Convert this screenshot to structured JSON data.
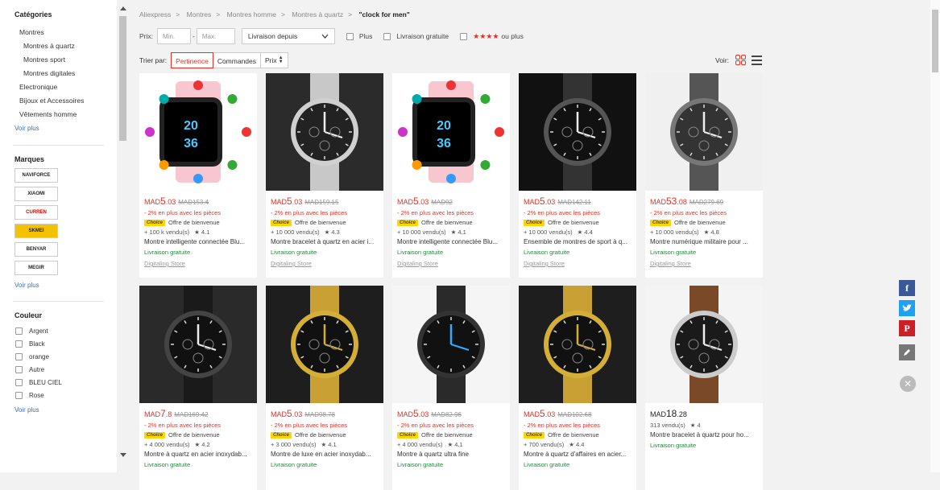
{
  "sidebar": {
    "categories_title": "Catégories",
    "categories": [
      {
        "label": "Montres",
        "sub": false
      },
      {
        "label": "Montres à quartz",
        "sub": true
      },
      {
        "label": "Montres sport",
        "sub": true
      },
      {
        "label": "Montres digitales",
        "sub": true
      },
      {
        "label": "Electronique",
        "sub": false
      },
      {
        "label": "Bijoux et Accessoires",
        "sub": false
      },
      {
        "label": "Vêtements homme",
        "sub": false
      }
    ],
    "see_more": "Voir plus",
    "brands_title": "Marques",
    "brands": [
      "NAVIFORCE",
      "XIAOMI",
      "CURREN",
      "SKMEI",
      "BENYAR",
      "MEGIR"
    ],
    "colors_title": "Couleur",
    "colors": [
      "Argent",
      "Black",
      "orange",
      "Autre",
      "BLEU CIEL",
      "Rose"
    ]
  },
  "breadcrumb": [
    "Aliexpress",
    "Montres",
    "Montres homme",
    "Montres à quartz"
  ],
  "search_query": "\"clock for men\"",
  "filters": {
    "price_label": "Prix:",
    "min_placeholder": "Min.",
    "max_placeholder": "Max.",
    "dash": "-",
    "ship_from": "Livraison depuis",
    "plus": "Plus",
    "free_shipping": "Livraison gratuite",
    "stars": "★★★★",
    "stars_suffix": "ou plus"
  },
  "sort": {
    "label": "Trier par:",
    "options": [
      "Pertinence",
      "Commandes",
      "Prix"
    ],
    "view_label": "Voir:"
  },
  "products": [
    {
      "currency": "MAD",
      "price": "5",
      "cents": ".03",
      "old": "MAD153.4",
      "promo": "- 2% en plus avec les pièces",
      "offer": "Offre de bienvenue",
      "sold": "+ 100 k vendu(s)",
      "rating": "4.1",
      "title": "Montre intelligente connectée Blu...",
      "shipping": "Livraison gratuite",
      "store": "Digitaling Store"
    },
    {
      "currency": "MAD",
      "price": "5",
      "cents": ".03",
      "old": "MAD159.15",
      "promo": "- 2% en plus avec les pièces",
      "offer": "Offre de bienvenue",
      "sold": "+ 10 000 vendu(s)",
      "rating": "4.3",
      "title": "Montre bracelet à quartz en acier i...",
      "shipping": "Livraison gratuite",
      "store": "Digitaling Store"
    },
    {
      "currency": "MAD",
      "price": "5",
      "cents": ".03",
      "old": "MAD92",
      "promo": "- 2% en plus avec les pièces",
      "offer": "Offre de bienvenue",
      "sold": "+ 10 000 vendu(s)",
      "rating": "4.1",
      "title": "Montre intelligente connectée Blu...",
      "shipping": "Livraison gratuite",
      "store": "Digitaling Store"
    },
    {
      "currency": "MAD",
      "price": "5",
      "cents": ".03",
      "old": "MAD142.11",
      "promo": "- 2% en plus avec les pièces",
      "offer": "Offre de bienvenue",
      "sold": "+ 10 000 vendu(s)",
      "rating": "4.4",
      "title": "Ensemble de montres de sport à q...",
      "shipping": "Livraison gratuite",
      "store": "Digitaling Store"
    },
    {
      "currency": "MAD",
      "price": "53",
      "cents": ".08",
      "old": "MAD279.69",
      "promo": "- 2% en plus avec les pièces",
      "offer": "Offre de bienvenue",
      "sold": "+ 10 000 vendu(s)",
      "rating": "4.8",
      "title": "Montre numérique militaire pour ...",
      "shipping": "Livraison gratuite",
      "store": "Digitaling Store"
    },
    {
      "currency": "MAD",
      "price": "7",
      "cents": ".8",
      "old": "MAD169.42",
      "promo": "- 2% en plus avec les pièces",
      "offer": "Offre de bienvenue",
      "sold": "+ 4 000 vendu(s)",
      "rating": "4.2",
      "title": "Montre à quartz en acier inoxydab...",
      "shipping": "Livraison gratuite",
      "store": ""
    },
    {
      "currency": "MAD",
      "price": "5",
      "cents": ".03",
      "old": "MAD98.78",
      "promo": "- 2% en plus avec les pièces",
      "offer": "Offre de bienvenue",
      "sold": "+ 3 000 vendu(s)",
      "rating": "4.1",
      "title": "Montre de luxe en acier inoxydab...",
      "shipping": "Livraison gratuite",
      "store": ""
    },
    {
      "currency": "MAD",
      "price": "5",
      "cents": ".03",
      "old": "MAD82.96",
      "promo": "- 2% en plus avec les pièces",
      "offer": "Offre de bienvenue",
      "sold": "+ 4 000 vendu(s)",
      "rating": "4.1",
      "title": "Montre à quartz ultra fine",
      "shipping": "Livraison gratuite",
      "store": ""
    },
    {
      "currency": "MAD",
      "price": "5",
      "cents": ".03",
      "old": "MAD102.68",
      "promo": "- 2% en plus avec les pièces",
      "offer": "Offre de bienvenue",
      "sold": "+ 700 vendu(s)",
      "rating": "4.4",
      "title": "Montre à quartz d'affaires en acier...",
      "shipping": "Livraison gratuite",
      "store": ""
    },
    {
      "currency": "MAD",
      "price": "18",
      "cents": ".28",
      "old": "",
      "promo": "",
      "offer": "",
      "sold": "313 vendu(s)",
      "rating": "4",
      "title": "Montre bracelet à quartz pour ho...",
      "shipping": "Livraison gratuite",
      "store": ""
    }
  ],
  "colors": {
    "accent": "#e43225",
    "green": "#1a8b39",
    "choice": "#ffd500"
  }
}
